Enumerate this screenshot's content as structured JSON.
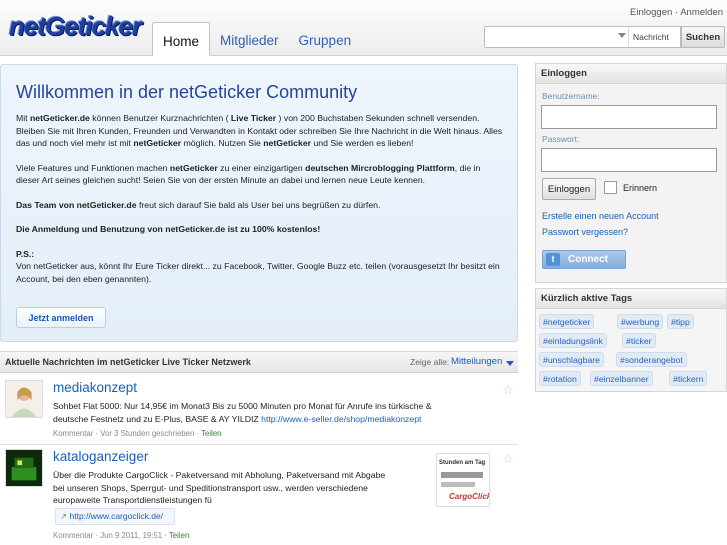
{
  "header": {
    "logo": "netGeticker",
    "login_link": "Einloggen",
    "separator": "·",
    "register_link": "Anmelden",
    "tabs": [
      {
        "label": "Home",
        "active": true
      },
      {
        "label": "Mitglieder",
        "active": false
      },
      {
        "label": "Gruppen",
        "active": false
      }
    ],
    "search": {
      "value": "",
      "scope": "Nachricht",
      "button": "Suchen"
    }
  },
  "welcome": {
    "title": "Willkommen in der netGeticker Community",
    "p1a": "Mit ",
    "p1b": "netGeticker.de",
    "p1c": " können Benutzer Kurznachrichten ( ",
    "p1d": "Live Ticker",
    "p1e": " ) von 200 Buchstaben Sekunden schnell versenden. Bleiben Sie mit Ihren Kunden, Freunden und Verwandten in Kontakt oder schreiben Sie Ihre Nachricht in die Welt hinaus. Alles das und noch viel mehr ist mit ",
    "p1f": "netGeticker",
    "p1g": " möglich. Nutzen Sie ",
    "p1h": "netGeticker",
    "p1i": " und Sie werden es lieben!",
    "p2a": "Viele Features und Funktionen machen ",
    "p2b": "netGeticker",
    "p2c": " zu einer einzigartigen ",
    "p2d": "deutschen Mircroblogging Plattform",
    "p2e": ", die in dieser Art seines gleichen sucht! Seien Sie von der ersten Minute an dabei und lernen neue Leute kennen.",
    "p3a": "Das Team von netGeticker.de",
    "p3b": " freut sich darauf Sie bald als User bei uns begrüßen zu dürfen.",
    "p4": "Die Anmeldung und Benutzung von netGeticker.de ist zu 100% kostenlos!",
    "ps_title": "P.S.:",
    "ps_text": "Von netGeticker aus, könnt Ihr Eure Ticker direkt... zu Facebook, Twitter, Google Buzz etc. teilen (vorausgesetzt Ihr besitzt ein Account, bei den eben genannten).",
    "signup_button": "Jetzt anmelden"
  },
  "news": {
    "title": "Aktuelle Nachrichten im netGeticker Live Ticker Netzwerk",
    "show_label": "Zeige alle:",
    "filter_value": "Mitteilungen",
    "items": [
      {
        "user": "mediakonzept",
        "text1": "Sohbet Flat 5000: Nur 14,95€ im Monat3 Bis zu 5000 Minuten pro Monat für Anrufe ins türkische &",
        "text2": "deutsche Festnetz und zu E-Plus, BASE & AY YILDIZ ",
        "link": "http://www.e-seller.de/shop/mediakonzept",
        "comment": "Kommentar",
        "time": "Vor 3 Stunden geschrieben",
        "share": "Teilen"
      },
      {
        "user": "kataloganzeiger",
        "text1": "Über die Produkte CargoClick - Paketversand mit Abholung, Paketversand mit Abgabe",
        "text2": "bei unseren Shops, Sperrgut- und Speditionstransport usw., werden verschiedene",
        "text3": "europaweite Transportdienstleistungen fü",
        "link": "http://www.cargoclick.de/",
        "comment": "Kommentar",
        "time": "Jun 9 2011, 19:51",
        "share": "Teilen",
        "thumb_line1": "Stunden am Tag",
        "thumb_line2": "CargoClick"
      }
    ]
  },
  "login": {
    "title": "Einloggen",
    "username_label": "Benutzername:",
    "password_label": "Passwort:",
    "button": "Einloggen",
    "remember": "Erinnern",
    "create_account": "Erstelle einen neuen Account",
    "forgot": "Passwort vergessen?",
    "connect": "Connect",
    "twitter_glyph": "t"
  },
  "tags": {
    "title": "Kürzlich aktive Tags",
    "items": [
      "#netgeticker",
      "#werbung",
      "#tipp",
      "#einladungslink",
      "#ticker",
      "#unschlagbare",
      "#sonderangebot",
      "#rotation",
      "#einzelbanner",
      "#tickern"
    ]
  },
  "colors": {
    "brand": "#1e3f9c",
    "link": "#1a5fb4",
    "share": "#2a8a2a"
  },
  "icons": {
    "star": "☆",
    "link_arrow": "↗"
  }
}
